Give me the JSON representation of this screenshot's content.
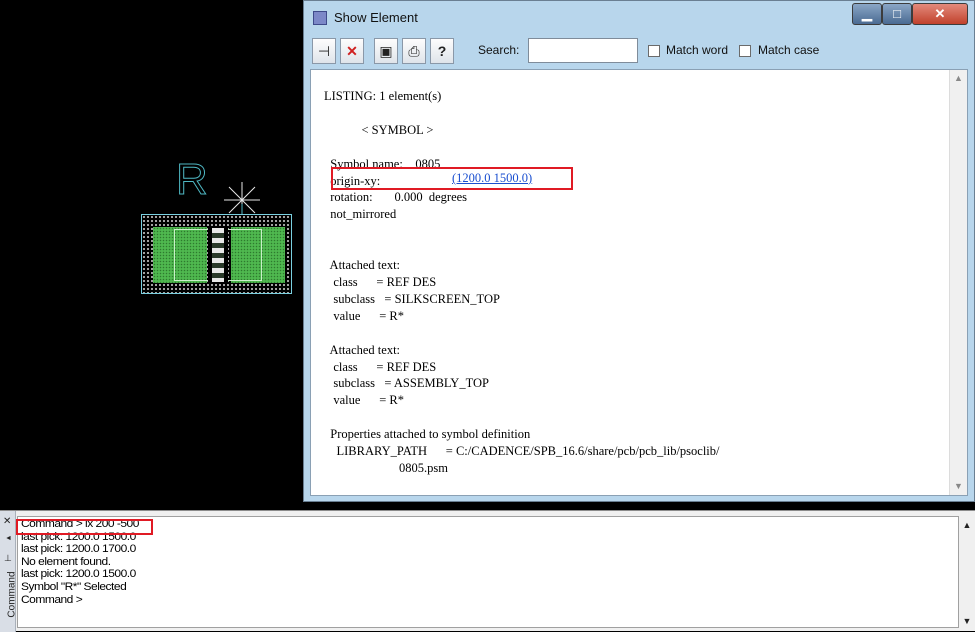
{
  "canvas": {
    "ref_designator": "R"
  },
  "window": {
    "title": "Show Element",
    "controls": {
      "minimize": "▁",
      "maximize": "□",
      "close": "✕"
    },
    "toolbar": {
      "icons": [
        "pin-icon",
        "close-icon",
        "save-icon",
        "print-icon",
        "help-icon"
      ],
      "search_label": "Search:",
      "search_value": "",
      "match_word_label": "Match word",
      "match_word_checked": false,
      "match_case_label": "Match case",
      "match_case_checked": false
    },
    "listing": {
      "lines": [
        "LISTING: 1 element(s)",
        "",
        "            < SYMBOL >",
        "",
        "  Symbol name:    0805",
        "  origin-xy:",
        "  rotation:       0.000  degrees",
        "  not_mirrored",
        "",
        "",
        "  Attached text:",
        "   class      = REF DES",
        "   subclass   = SILKSCREEN_TOP",
        "   value      = R*",
        "",
        "  Attached text:",
        "   class      = REF DES",
        "   subclass   = ASSEMBLY_TOP",
        "   value      = R*",
        "",
        "  Properties attached to symbol definition",
        "    LIBRARY_PATH      = C:/CADENCE/SPB_16.6/share/pcb/pcb_lib/psoclib/",
        "                        0805.psm"
      ],
      "origin_value": "(1200.0 1500.0)"
    }
  },
  "console": {
    "title": "Command",
    "lines": [
      "Command > ix 200 -500",
      "last pick:  1200.0 1500.0",
      "last pick:  1200.0 1700.0",
      "No element found.",
      "last pick:  1200.0 1500.0",
      "Symbol \"R*\" Selected",
      "Command >"
    ]
  },
  "colors": {
    "highlight": "#e01a24",
    "pad": "#4fb84f",
    "silkscreen": "#4fb8c4",
    "link": "#1a4fd0",
    "window_frame": "#b8d6ec"
  }
}
